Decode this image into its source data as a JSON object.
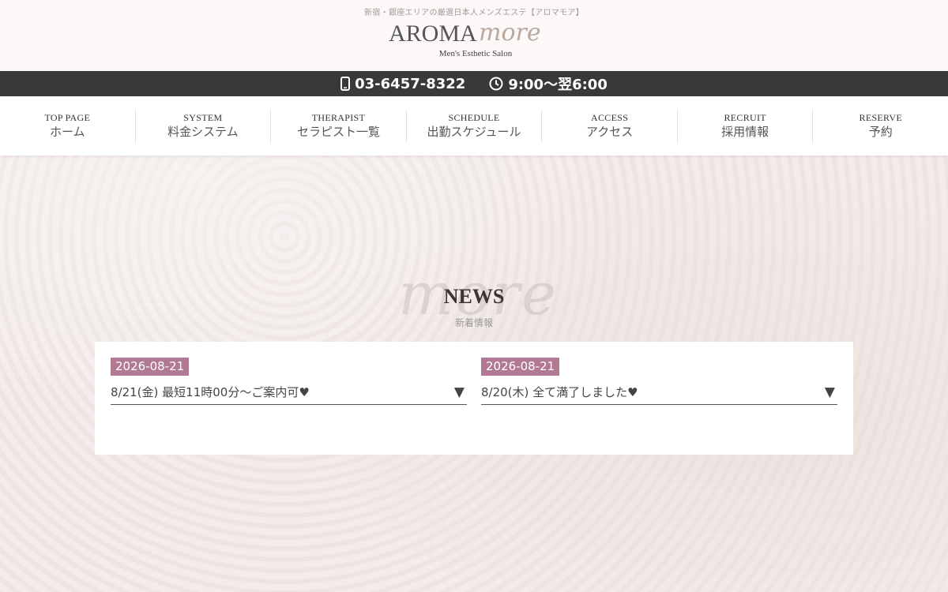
{
  "header": {
    "tagline": "新宿・銀座エリアの厳選日本人メンズエステ【アロマモア】",
    "logo_main": "AROMA",
    "logo_script": "more",
    "logo_sub": "Men's Esthetic Salon"
  },
  "contact": {
    "phone": "03-6457-8322",
    "hours": "9:00〜翌6:00",
    "phone_icon": "mobile-phone-icon",
    "hours_icon": "clock-icon"
  },
  "nav": {
    "items": [
      {
        "en": "TOP PAGE",
        "ja": "ホーム"
      },
      {
        "en": "SYSTEM",
        "ja": "料金システム"
      },
      {
        "en": "THERAPIST",
        "ja": "セラピスト一覧"
      },
      {
        "en": "SCHEDULE",
        "ja": "出勤スケジュール"
      },
      {
        "en": "ACCESS",
        "ja": "アクセス"
      },
      {
        "en": "RECRUIT",
        "ja": "採用情報"
      },
      {
        "en": "RESERVE",
        "ja": "予約"
      }
    ]
  },
  "news": {
    "watermark": "more",
    "title": "NEWS",
    "subtitle": "新着情報",
    "entries": [
      {
        "date": "2026-08-21",
        "text": "8/21(金) 最短11時00分〜ご案内可♥",
        "toggle": "▼"
      },
      {
        "date": "2026-08-21",
        "text": "8/20(木) 全て満了しました♥",
        "toggle": "▼"
      }
    ]
  },
  "colors": {
    "accent": "#b27994",
    "bar": "#3a3939",
    "background": "#f3ecea"
  }
}
